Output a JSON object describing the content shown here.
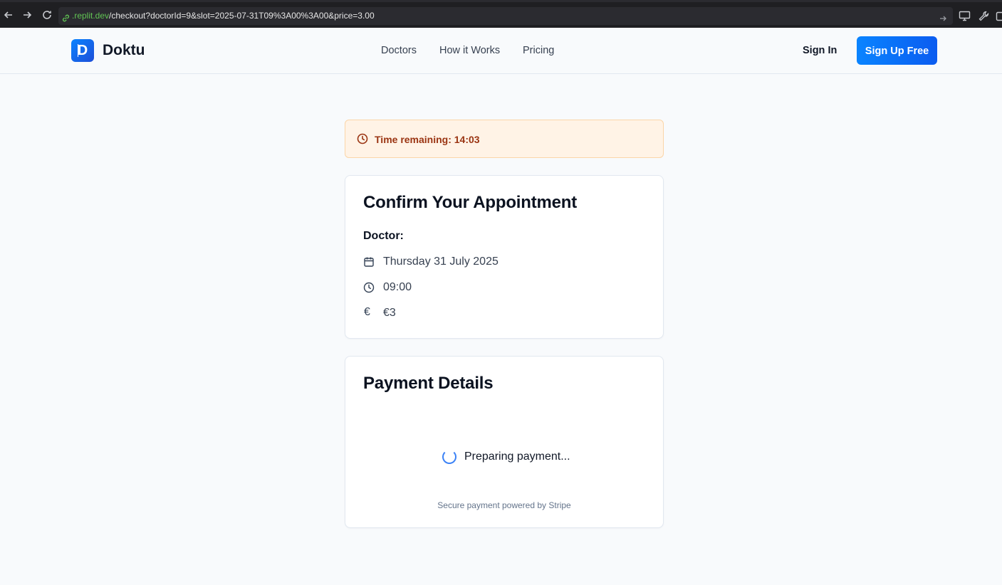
{
  "browser": {
    "url_host": ".replit.dev",
    "url_path": "/checkout?doctorId=9&slot=2025-07-31T09%3A00%3A00&price=3.00"
  },
  "header": {
    "logo_letter": "D",
    "brand": "Doktu",
    "nav": [
      {
        "label": "Doctors"
      },
      {
        "label": "How it Works"
      },
      {
        "label": "Pricing"
      }
    ],
    "sign_in": "Sign In",
    "sign_up": "Sign Up Free"
  },
  "timer": {
    "text": "Time remaining: 14:03",
    "icon": "clock-icon"
  },
  "appointment": {
    "title": "Confirm Your Appointment",
    "doctor_label": "Doctor:",
    "date": "Thursday 31 July 2025",
    "time": "09:00",
    "currency_symbol": "€",
    "price": "€3",
    "icons": [
      "calendar-icon",
      "clock-icon",
      "euro-icon"
    ]
  },
  "payment": {
    "title": "Payment Details",
    "status": "Preparing payment...",
    "secure_note": "Secure payment powered by Stripe"
  },
  "colors": {
    "primary": "#0a84ff",
    "timer_bg": "#fff3e6",
    "timer_text": "#9a3412",
    "spinner": "#3b82f6"
  }
}
